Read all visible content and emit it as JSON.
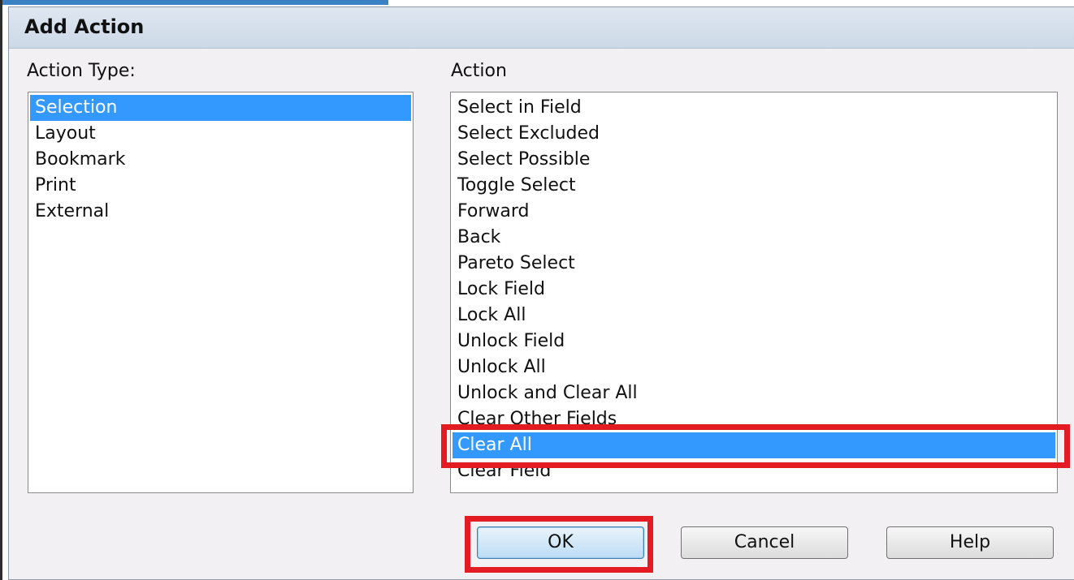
{
  "dialog": {
    "title": "Add Action",
    "action_type_label": "Action Type:",
    "action_label": "Action",
    "action_types": [
      {
        "label": "Selection",
        "selected": true
      },
      {
        "label": "Layout",
        "selected": false
      },
      {
        "label": "Bookmark",
        "selected": false
      },
      {
        "label": "Print",
        "selected": false
      },
      {
        "label": "External",
        "selected": false
      }
    ],
    "actions": [
      {
        "label": "Select in Field",
        "selected": false
      },
      {
        "label": "Select Excluded",
        "selected": false
      },
      {
        "label": "Select Possible",
        "selected": false
      },
      {
        "label": "Toggle Select",
        "selected": false
      },
      {
        "label": "Forward",
        "selected": false
      },
      {
        "label": "Back",
        "selected": false
      },
      {
        "label": "Pareto Select",
        "selected": false
      },
      {
        "label": "Lock Field",
        "selected": false
      },
      {
        "label": "Lock All",
        "selected": false
      },
      {
        "label": "Unlock Field",
        "selected": false
      },
      {
        "label": "Unlock All",
        "selected": false
      },
      {
        "label": "Unlock and Clear All",
        "selected": false
      },
      {
        "label": "Clear Other Fields",
        "selected": false
      },
      {
        "label": "Clear All",
        "selected": true
      },
      {
        "label": "Clear Field",
        "selected": false
      }
    ],
    "buttons": {
      "ok": "OK",
      "cancel": "Cancel",
      "help": "Help"
    }
  },
  "colors": {
    "selection": "#3399ff",
    "annotation": "#e31b23"
  }
}
